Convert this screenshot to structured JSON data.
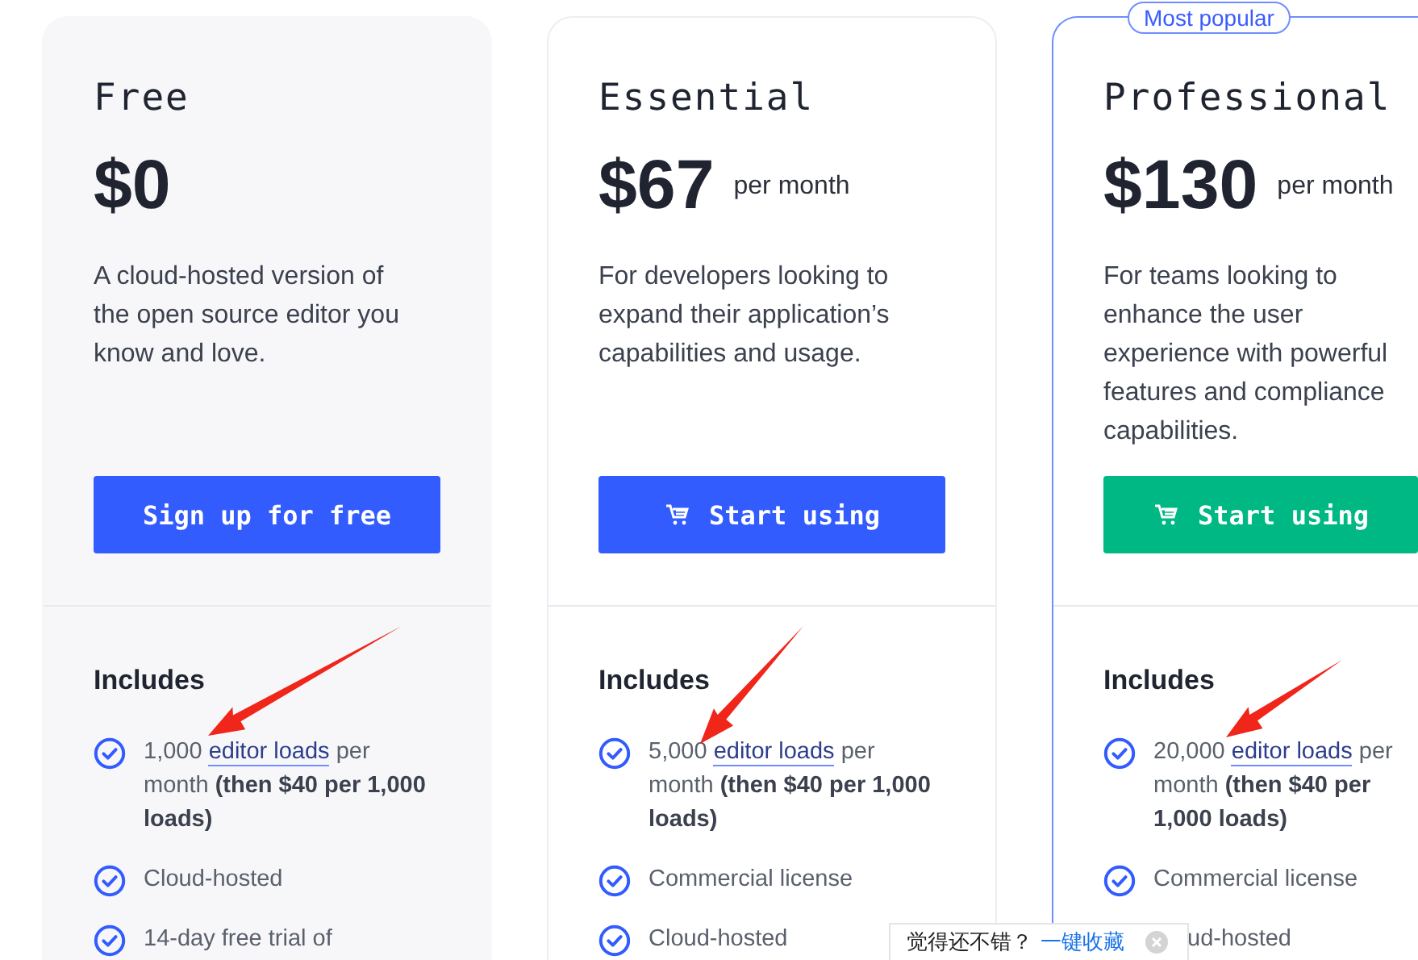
{
  "plans": [
    {
      "name": "Free",
      "price": "$0",
      "description": "A cloud-hosted version of the open source editor you know and love.",
      "cta": {
        "label": "Sign up for free",
        "icon": false
      },
      "includes_title": "Includes",
      "arrow": true,
      "features": [
        {
          "kind": "link",
          "lead": "1,000",
          "link": "editor loads",
          "rest": "per month",
          "bold": "(then $40 per 1,000 loads)"
        },
        {
          "kind": "plain",
          "text": "Cloud-hosted"
        },
        {
          "kind": "plain",
          "text": "14-day free trial of"
        }
      ]
    },
    {
      "name": "Essential",
      "price": "$67",
      "period": "per month",
      "description": "For developers looking to expand their application’s capabilities and usage.",
      "cta": {
        "label": "Start using",
        "icon": true
      },
      "includes_title": "Includes",
      "arrow": true,
      "features": [
        {
          "kind": "link",
          "lead": "5,000",
          "link": "editor loads",
          "rest": "per month",
          "bold": "(then $40 per 1,000 loads)"
        },
        {
          "kind": "plain",
          "text": "Commercial license"
        },
        {
          "kind": "plain",
          "text": "Cloud-hosted"
        }
      ]
    },
    {
      "name": "Professional",
      "price": "$130",
      "period": "per month",
      "badge": "Most popular",
      "description": "For teams looking to enhance the user experience with powerful features and compliance capabilities.",
      "cta": {
        "label": "Start using",
        "icon": true
      },
      "includes_title": "Includes",
      "arrow": true,
      "features": [
        {
          "kind": "link",
          "lead": "20,000",
          "link": "editor loads",
          "rest": "per month",
          "bold": "(then $40 per 1,000 loads)"
        },
        {
          "kind": "plain",
          "text": "Commercial license"
        },
        {
          "kind": "covered",
          "text": "ud-hosted"
        }
      ]
    }
  ],
  "popup": {
    "text": "觉得还不错？",
    "link": "一键收藏"
  }
}
